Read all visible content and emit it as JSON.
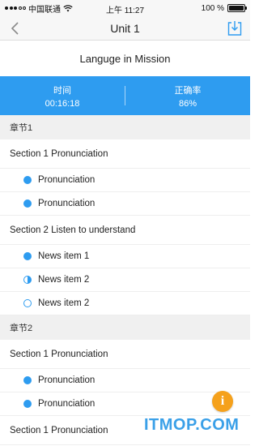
{
  "status_bar": {
    "carrier": "中国联通",
    "time": "上午 11:27",
    "battery_text": "100 %",
    "battery_level": 1.0
  },
  "nav": {
    "title": "Unit 1",
    "back_icon": "chevron-left-icon",
    "download_icon": "download-icon"
  },
  "course": {
    "title": "Languge in Mission"
  },
  "stats": {
    "time_label": "时间",
    "time_value": "00:16:18",
    "accuracy_label": "正确率",
    "accuracy_value": "86%"
  },
  "chapters": [
    {
      "header": "章节1",
      "sections": [
        {
          "title": "Section 1 Pronunciation",
          "items": [
            {
              "label": "Pronunciation",
              "status": "full"
            },
            {
              "label": "Pronunciation",
              "status": "full"
            }
          ]
        },
        {
          "title": "Section 2 Listen to understand",
          "items": [
            {
              "label": "News item 1",
              "status": "full"
            },
            {
              "label": "News item 2",
              "status": "half"
            },
            {
              "label": "News item 2",
              "status": "empty"
            }
          ]
        }
      ]
    },
    {
      "header": "章节2",
      "sections": [
        {
          "title": "Section 1 Pronunciation",
          "items": [
            {
              "label": "Pronunciation",
              "status": "full"
            },
            {
              "label": "Pronunciation",
              "status": "full"
            }
          ]
        },
        {
          "title": "Section 1 Pronunciation",
          "items": []
        }
      ]
    }
  ],
  "floating_button": {
    "label": "i",
    "color": "#f5a11c"
  },
  "watermark": "ITMOP.COM",
  "colors": {
    "accent": "#2e9cf0"
  }
}
